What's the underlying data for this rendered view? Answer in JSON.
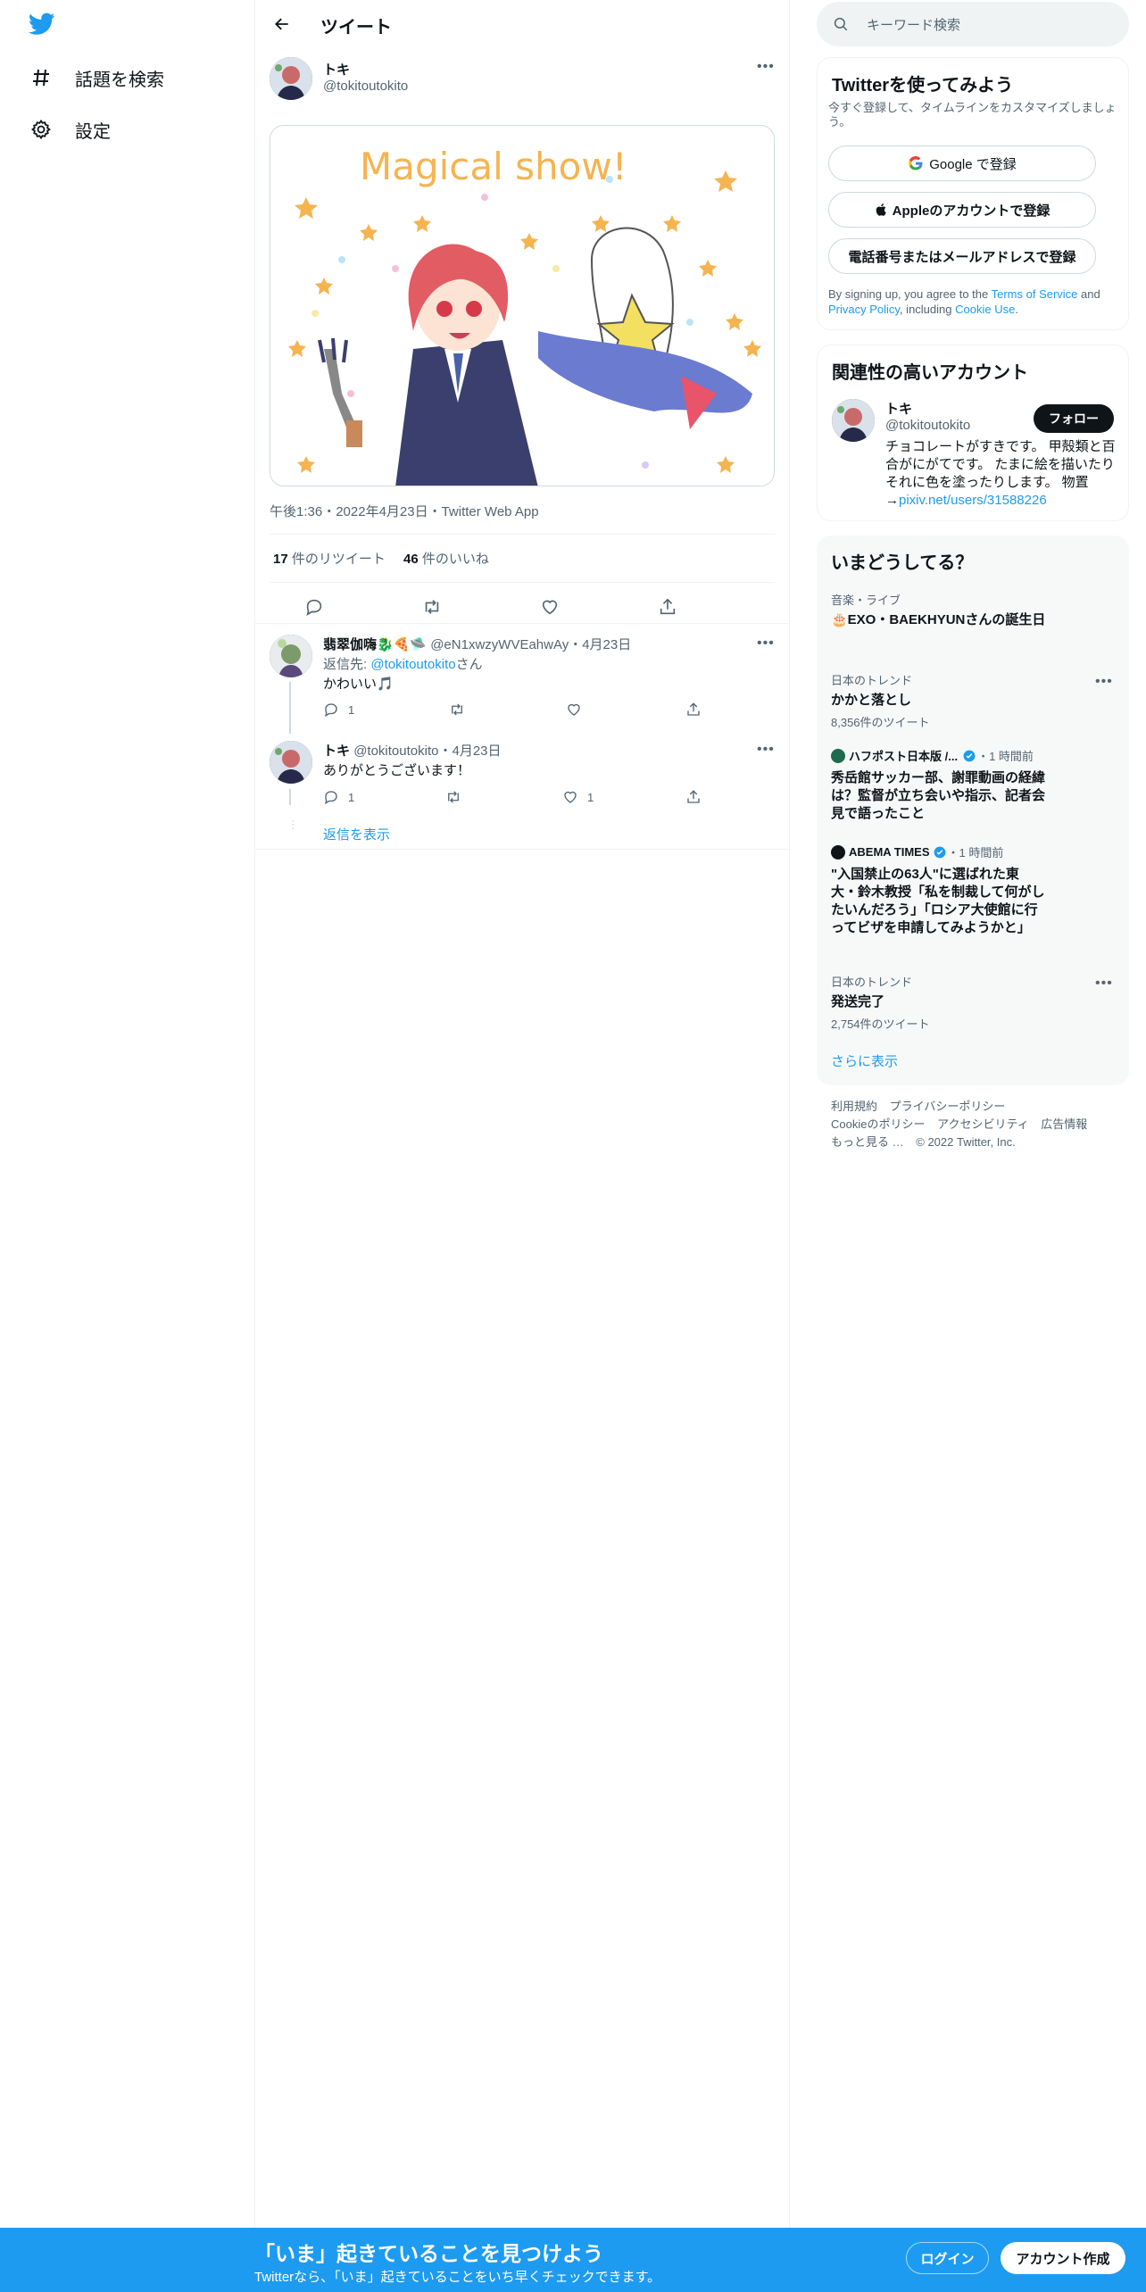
{
  "colors": {
    "accent": "#1d9bf0",
    "text": "#0f1419",
    "muted": "#536471",
    "border": "#eff3f4",
    "verified": "#1d9bf0"
  },
  "nav": {
    "logo": "twitter-bird-icon",
    "items": [
      {
        "label": "話題を検索",
        "icon": "hashtag-icon"
      },
      {
        "label": "設定",
        "icon": "gear-icon"
      }
    ]
  },
  "header": {
    "title": "ツイート",
    "back_icon": "back-arrow-icon"
  },
  "tweet": {
    "author_name": "トキ",
    "author_handle": "@tokitoutokito",
    "image_text": "Magical show!",
    "meta": "午後1:36・2022年4月23日・Twitter Web App",
    "retweets_count": "17",
    "retweets_label": "件のリツイート",
    "likes_count": "46",
    "likes_label": "件のいいね"
  },
  "replies": [
    {
      "name": "翡翠伽嗨🐉🍕🛸",
      "handle": "@eN1xwzyWVEahwAy",
      "sep": "・",
      "date": "4月23日",
      "reply_to_prefix": "返信先: ",
      "reply_to_handle": "@tokitoutokito",
      "reply_to_suffix": "さん",
      "text": "かわいい🎵",
      "reply_count": "1",
      "like_count": ""
    },
    {
      "name": "トキ",
      "handle": "@tokitoutokito",
      "sep": "・",
      "date": "4月23日",
      "text": "ありがとうございます！",
      "reply_count": "1",
      "like_count": "1"
    }
  ],
  "show_replies": "返信を表示",
  "right": {
    "search_placeholder": "キーワード検索",
    "signup": {
      "title": "Twitterを使ってみよう",
      "subtitle": "今すぐ登録して、タイムラインをカスタマイズしましょう。",
      "google_btn": "Google で登録",
      "apple_btn": "Appleのアカウントで登録",
      "phone_btn": "電話番号またはメールアドレスで登録",
      "terms_prefix": "By signing up, you agree to the ",
      "terms_link": "Terms of Service",
      "terms_and": " and ",
      "privacy_link": "Privacy Policy",
      "including": ", including ",
      "cookie_link": "Cookie Use",
      "period": "."
    },
    "related": {
      "title": "関連性の高いアカウント",
      "name": "トキ",
      "handle": "@tokitoutokito",
      "follow_label": "フォロー",
      "bio": "チョコレートがすきです。 甲殻類と百合がにがてです。 たまに絵を描いたりそれに色を塗ったりします。 物置→",
      "bio_link": "pixiv.net/users/31588226"
    },
    "trends": {
      "title": "いまどうしてる？",
      "items": [
        {
          "category": "音楽・ライブ",
          "title": "🎂EXO・BAEKHYUNさんの誕生日"
        },
        {
          "category": "日本のトレンド",
          "title": "かかと落とし",
          "count": "8,356件のツイート"
        },
        {
          "source": "ハフポスト日本版 /...",
          "time": "・1 時間前",
          "title": "秀岳館サッカー部、謝罪動画の経緯は？監督が立ち会いや指示、記者会見で語ったこと"
        },
        {
          "source": "ABEMA TIMES",
          "time": "・1 時間前",
          "title": "\"入国禁止の63人\"に選ばれた東大・鈴木教授「私を制裁して何がしたいんだろう」「ロシア大使館に行ってビザを申請してみようかと」"
        },
        {
          "category": "日本のトレンド",
          "title": "発送完了",
          "count": "2,754件のツイート"
        }
      ],
      "show_more": "さらに表示"
    },
    "footer": {
      "line1": [
        "利用規約",
        "プライバシーポリシー"
      ],
      "line2": [
        "Cookieのポリシー",
        "アクセシビリティ",
        "広告情報"
      ],
      "line3_more": "もっと見る …",
      "copyright": "© 2022 Twitter, Inc."
    }
  },
  "bottom_bar": {
    "title": "「いま」起きていることを見つけよう",
    "subtitle": "Twitterなら、「いま」起きていることをいち早くチェックできます。",
    "login": "ログイン",
    "signup": "アカウント作成"
  }
}
